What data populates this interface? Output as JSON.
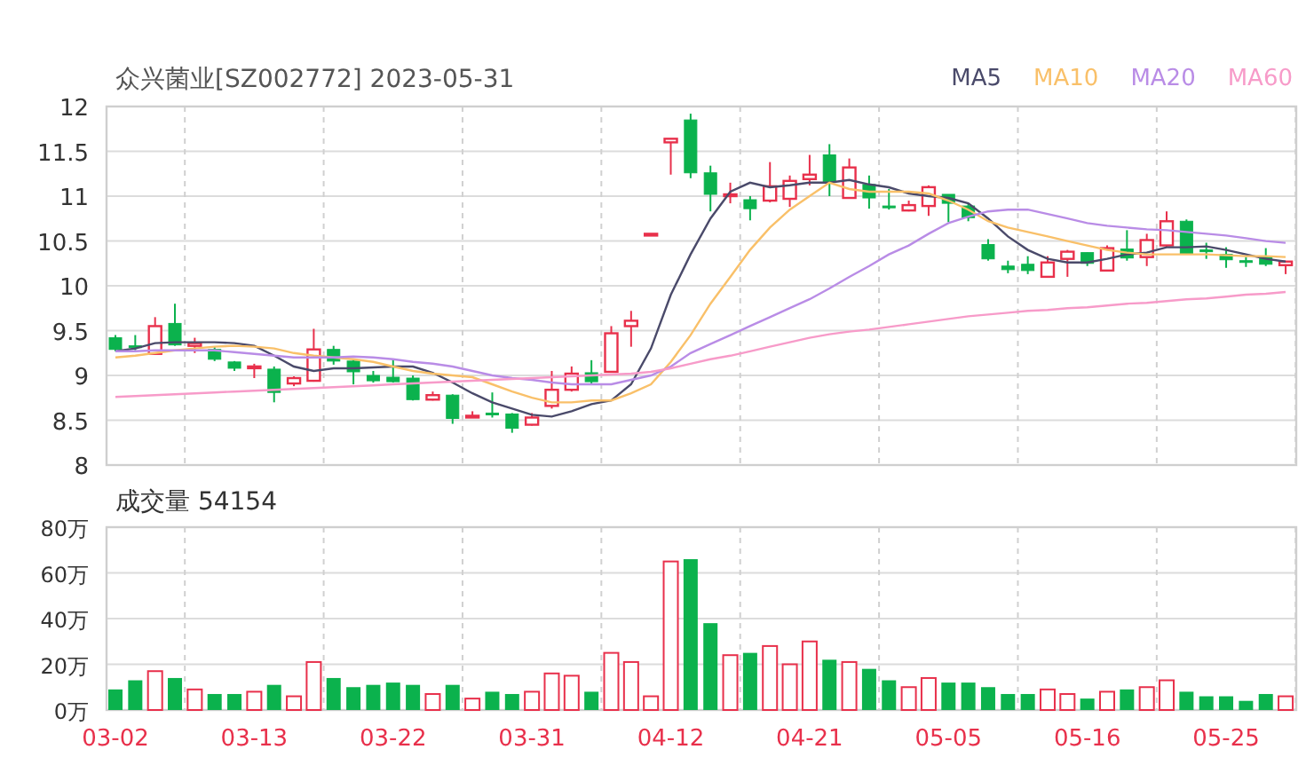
{
  "price_chart": {
    "chart_data": {
      "type": "candlestick",
      "title": "众兴菌业[SZ002772] 2023-05-31",
      "ylim": [
        8,
        12
      ],
      "yticks": [
        8,
        8.5,
        9,
        9.5,
        10,
        10.5,
        11,
        11.5,
        12
      ],
      "grid": true,
      "ohlc": [
        [
          9.42,
          9.45,
          9.27,
          9.29
        ],
        [
          9.33,
          9.45,
          9.28,
          9.31
        ],
        [
          9.24,
          9.65,
          9.24,
          9.55
        ],
        [
          9.58,
          9.8,
          9.33,
          9.34
        ],
        [
          9.33,
          9.42,
          9.25,
          9.36
        ],
        [
          9.29,
          9.32,
          9.16,
          9.18
        ],
        [
          9.15,
          9.16,
          9.05,
          9.08
        ],
        [
          9.09,
          9.13,
          8.97,
          9.1
        ],
        [
          9.07,
          9.1,
          8.7,
          8.81
        ],
        [
          8.91,
          8.99,
          8.88,
          8.97
        ],
        [
          8.94,
          9.52,
          8.93,
          9.29
        ],
        [
          9.29,
          9.33,
          9.12,
          9.16
        ],
        [
          9.16,
          9.17,
          8.9,
          9.04
        ],
        [
          9.0,
          9.05,
          8.92,
          8.94
        ],
        [
          8.98,
          9.18,
          8.92,
          8.93
        ],
        [
          8.97,
          9.0,
          8.72,
          8.73
        ],
        [
          8.73,
          8.82,
          8.72,
          8.78
        ],
        [
          8.78,
          8.79,
          8.46,
          8.52
        ],
        [
          8.54,
          8.6,
          8.53,
          8.55
        ],
        [
          8.58,
          8.81,
          8.53,
          8.56
        ],
        [
          8.57,
          8.58,
          8.36,
          8.41
        ],
        [
          8.45,
          8.58,
          8.44,
          8.53
        ],
        [
          8.66,
          9.05,
          8.63,
          8.84
        ],
        [
          8.84,
          9.1,
          8.82,
          9.02
        ],
        [
          9.03,
          9.17,
          8.91,
          8.93
        ],
        [
          9.04,
          9.55,
          9.03,
          9.47
        ],
        [
          9.55,
          9.72,
          9.32,
          9.61
        ],
        [
          10.57,
          10.58,
          10.57,
          10.58
        ],
        [
          11.6,
          11.64,
          11.24,
          11.64
        ],
        [
          11.85,
          11.92,
          11.2,
          11.26
        ],
        [
          11.26,
          11.34,
          10.83,
          11.02
        ],
        [
          11.0,
          11.15,
          10.92,
          11.02
        ],
        [
          10.96,
          11.0,
          10.73,
          10.86
        ],
        [
          10.95,
          11.38,
          10.93,
          11.11
        ],
        [
          10.97,
          11.23,
          10.88,
          11.17
        ],
        [
          11.19,
          11.46,
          11.12,
          11.24
        ],
        [
          11.46,
          11.58,
          11.0,
          11.16
        ],
        [
          10.98,
          11.42,
          10.98,
          11.32
        ],
        [
          11.13,
          11.23,
          10.86,
          10.98
        ],
        [
          10.89,
          11.08,
          10.85,
          10.87
        ],
        [
          10.84,
          10.95,
          10.83,
          10.9
        ],
        [
          10.89,
          11.12,
          10.78,
          11.1
        ],
        [
          11.02,
          11.02,
          10.71,
          10.92
        ],
        [
          10.89,
          10.92,
          10.72,
          10.76
        ],
        [
          10.46,
          10.52,
          10.28,
          10.3
        ],
        [
          10.22,
          10.28,
          10.14,
          10.18
        ],
        [
          10.24,
          10.33,
          10.13,
          10.17
        ],
        [
          10.1,
          10.33,
          10.1,
          10.26
        ],
        [
          10.3,
          10.4,
          10.1,
          10.38
        ],
        [
          10.37,
          10.37,
          10.22,
          10.25
        ],
        [
          10.17,
          10.45,
          10.16,
          10.42
        ],
        [
          10.41,
          10.62,
          10.28,
          10.31
        ],
        [
          10.32,
          10.58,
          10.22,
          10.51
        ],
        [
          10.45,
          10.83,
          10.43,
          10.72
        ],
        [
          10.72,
          10.74,
          10.36,
          10.36
        ],
        [
          10.4,
          10.48,
          10.3,
          10.38
        ],
        [
          10.35,
          10.43,
          10.2,
          10.29
        ],
        [
          10.28,
          10.32,
          10.21,
          10.27
        ],
        [
          10.32,
          10.42,
          10.22,
          10.24
        ],
        [
          10.23,
          10.27,
          10.13,
          10.27
        ]
      ],
      "series": [
        {
          "name": "MA5",
          "type": "line",
          "color": "#4a4a6a",
          "values": [
            9.27,
            9.3,
            9.36,
            9.37,
            9.37,
            9.37,
            9.36,
            9.33,
            9.22,
            9.1,
            9.05,
            9.08,
            9.08,
            9.09,
            9.1,
            9.1,
            9.03,
            8.92,
            8.8,
            8.7,
            8.63,
            8.56,
            8.54,
            8.6,
            8.68,
            8.72,
            8.9,
            9.3,
            9.9,
            10.35,
            10.75,
            11.05,
            11.15,
            11.1,
            11.12,
            11.15,
            11.15,
            11.18,
            11.13,
            11.1,
            11.03,
            11.0,
            10.98,
            10.92,
            10.75,
            10.55,
            10.4,
            10.3,
            10.26,
            10.26,
            10.3,
            10.35,
            10.37,
            10.43,
            10.43,
            10.44,
            10.4,
            10.35,
            10.3,
            10.27
          ]
        },
        {
          "name": "MA10",
          "type": "line",
          "color": "#f9c069",
          "values": [
            9.2,
            9.22,
            9.25,
            9.28,
            9.3,
            9.32,
            9.33,
            9.32,
            9.3,
            9.25,
            9.22,
            9.2,
            9.18,
            9.15,
            9.1,
            9.05,
            9.02,
            9.0,
            8.98,
            8.9,
            8.82,
            8.75,
            8.7,
            8.7,
            8.72,
            8.72,
            8.8,
            8.9,
            9.15,
            9.45,
            9.8,
            10.1,
            10.4,
            10.65,
            10.85,
            11.0,
            11.15,
            11.08,
            11.05,
            11.05,
            11.05,
            11.03,
            10.95,
            10.85,
            10.72,
            10.65,
            10.6,
            10.55,
            10.5,
            10.45,
            10.4,
            10.37,
            10.35,
            10.35,
            10.35,
            10.35,
            10.34,
            10.33,
            10.33,
            10.32
          ]
        },
        {
          "name": "MA20",
          "type": "line",
          "color": "#b98ce6",
          "values": [
            9.27,
            9.27,
            9.28,
            9.28,
            9.28,
            9.28,
            9.26,
            9.24,
            9.22,
            9.2,
            9.2,
            9.2,
            9.21,
            9.2,
            9.18,
            9.15,
            9.13,
            9.1,
            9.05,
            9.0,
            8.97,
            8.95,
            8.92,
            8.9,
            8.9,
            8.9,
            8.95,
            9.0,
            9.1,
            9.25,
            9.35,
            9.45,
            9.55,
            9.65,
            9.75,
            9.85,
            9.97,
            10.1,
            10.22,
            10.35,
            10.45,
            10.58,
            10.7,
            10.77,
            10.83,
            10.85,
            10.85,
            10.8,
            10.75,
            10.7,
            10.67,
            10.65,
            10.63,
            10.62,
            10.6,
            10.58,
            10.56,
            10.53,
            10.5,
            10.48
          ]
        },
        {
          "name": "MA60",
          "type": "line",
          "color": "#f79bc9",
          "values": [
            8.76,
            8.77,
            8.78,
            8.79,
            8.8,
            8.81,
            8.82,
            8.83,
            8.84,
            8.85,
            8.86,
            8.87,
            8.88,
            8.89,
            8.9,
            8.91,
            8.92,
            8.93,
            8.94,
            8.95,
            8.96,
            8.97,
            8.98,
            8.99,
            9.0,
            9.01,
            9.02,
            9.04,
            9.08,
            9.13,
            9.18,
            9.22,
            9.27,
            9.32,
            9.37,
            9.42,
            9.46,
            9.49,
            9.51,
            9.54,
            9.57,
            9.6,
            9.63,
            9.66,
            9.68,
            9.7,
            9.72,
            9.73,
            9.75,
            9.76,
            9.78,
            9.8,
            9.81,
            9.83,
            9.85,
            9.86,
            9.88,
            9.9,
            9.91,
            9.93
          ]
        }
      ]
    }
  },
  "volume_chart": {
    "chart_data": {
      "type": "bar",
      "title": "成交量 54154",
      "ylim": [
        0,
        80
      ],
      "grid": true,
      "yticks": [
        {
          "value": 0,
          "label": "0万"
        },
        {
          "value": 20,
          "label": "20万"
        },
        {
          "value": 40,
          "label": "40万"
        },
        {
          "value": 60,
          "label": "60万"
        },
        {
          "value": 80,
          "label": "80万"
        }
      ],
      "series": [
        {
          "color": "#e8304b",
          "values": [
            null,
            null,
            17,
            null,
            9,
            null,
            null,
            8,
            null,
            6,
            21,
            null,
            null,
            null,
            null,
            null,
            7,
            null,
            5,
            null,
            null,
            8,
            16,
            15,
            null,
            25,
            21,
            6,
            65,
            null,
            null,
            24,
            null,
            28,
            20,
            30,
            null,
            21,
            null,
            null,
            10,
            14,
            null,
            null,
            null,
            null,
            null,
            9,
            7,
            null,
            8,
            null,
            10,
            13,
            null,
            null,
            null,
            null,
            null,
            6
          ]
        },
        {
          "color": "#0bb24d",
          "values": [
            9,
            13,
            null,
            14,
            null,
            7,
            7,
            null,
            11,
            null,
            null,
            14,
            10,
            11,
            12,
            11,
            null,
            11,
            null,
            8,
            7,
            null,
            null,
            null,
            8,
            null,
            null,
            null,
            null,
            66,
            38,
            null,
            25,
            null,
            null,
            null,
            22,
            null,
            18,
            13,
            null,
            null,
            12,
            12,
            10,
            7,
            7,
            null,
            null,
            5,
            null,
            9,
            null,
            null,
            8,
            6,
            6,
            4,
            7,
            null
          ]
        }
      ]
    },
    "date_labels": [
      "03-02",
      "03-13",
      "03-22",
      "03-31",
      "04-12",
      "04-21",
      "05-05",
      "05-16",
      "05-25"
    ]
  }
}
